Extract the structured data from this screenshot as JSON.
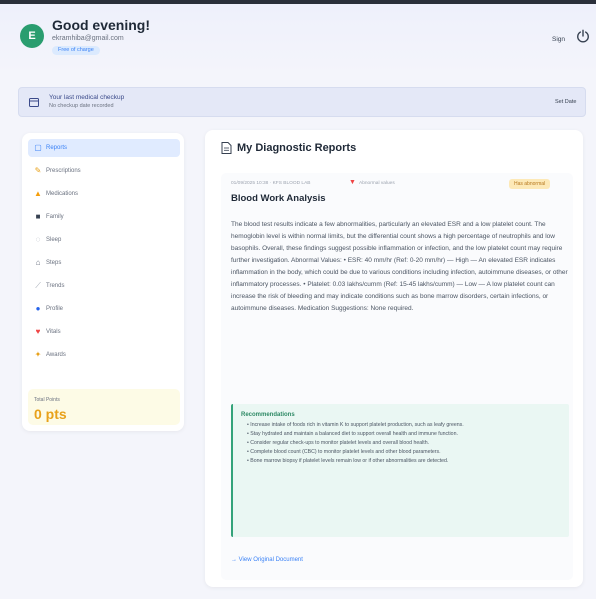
{
  "header": {
    "avatar_letter": "E",
    "greeting": "Good evening!",
    "email": "ekramhiba@gmail.com",
    "badge": "Free of charge",
    "sign_out": "Sign",
    "power_icon": "power-icon"
  },
  "reminder": {
    "title": "Your last medical checkup",
    "subtitle": "No checkup date recorded",
    "button": "Set Date"
  },
  "sidebar": {
    "items": [
      {
        "label": "Reports",
        "icon": "▢",
        "color": "#3b82f6",
        "active": true
      },
      {
        "label": "Prescriptions",
        "icon": "✎",
        "color": "#e8a11a"
      },
      {
        "label": "Medications",
        "icon": "▲",
        "color": "#f59e0b"
      },
      {
        "label": "Family",
        "icon": "■",
        "color": "#374151"
      },
      {
        "label": "Sleep",
        "icon": "◌",
        "color": "#9ca3af"
      },
      {
        "label": "Steps",
        "icon": "⌂",
        "color": "#6b7280"
      },
      {
        "label": "Trends",
        "icon": "⟋",
        "color": "#9ca3af"
      },
      {
        "label": "Profile",
        "icon": "●",
        "color": "#2563eb"
      },
      {
        "label": "Vitals",
        "icon": "♥",
        "color": "#ef4444"
      },
      {
        "label": "Awards",
        "icon": "✦",
        "color": "#e8a11a"
      }
    ],
    "points_label": "Total Points",
    "points_value": "0 pts"
  },
  "main": {
    "title": "My Diagnostic Reports",
    "report": {
      "meta": "01/09/2025 10:38 · KFS BLOOD LAB",
      "meta2": "Abnormal values",
      "status": "Has abnormal",
      "title": "Blood Work Analysis",
      "text": "The blood test results indicate a few abnormalities, particularly an elevated ESR and a low platelet count. The hemoglobin level is within normal limits, but the differential count shows a high percentage of neutrophils and low basophils. Overall, these findings suggest possible inflammation or infection, and the low platelet count may require further investigation. Abnormal Values: • ESR: 40 mm/hr (Ref: 0-20 mm/hr) — High — An elevated ESR indicates inflammation in the body, which could be due to various conditions including infection, autoimmune diseases, or other inflammatory processes. • Platelet: 0.03 lakhs/cumm (Ref: 15-45 lakhs/cumm) — Low — A low platelet count can increase the risk of bleeding and may indicate conditions such as bone marrow disorders, certain infections, or autoimmune diseases. Medication Suggestions: None required.",
      "recommendations_title": "Recommendations",
      "recommendations": [
        "• Increase intake of foods rich in vitamin K to support platelet production, such as leafy greens.",
        "• Stay hydrated and maintain a balanced diet to support overall health and immune function.",
        "• Consider regular check-ups to monitor platelet levels and overall blood health.",
        "• Complete blood count (CBC) to monitor platelet levels and other blood parameters.",
        "• Bone marrow biopsy if platelet levels remain low or if other abnormalities are detected."
      ],
      "view_link": "→ View Original Document"
    }
  }
}
